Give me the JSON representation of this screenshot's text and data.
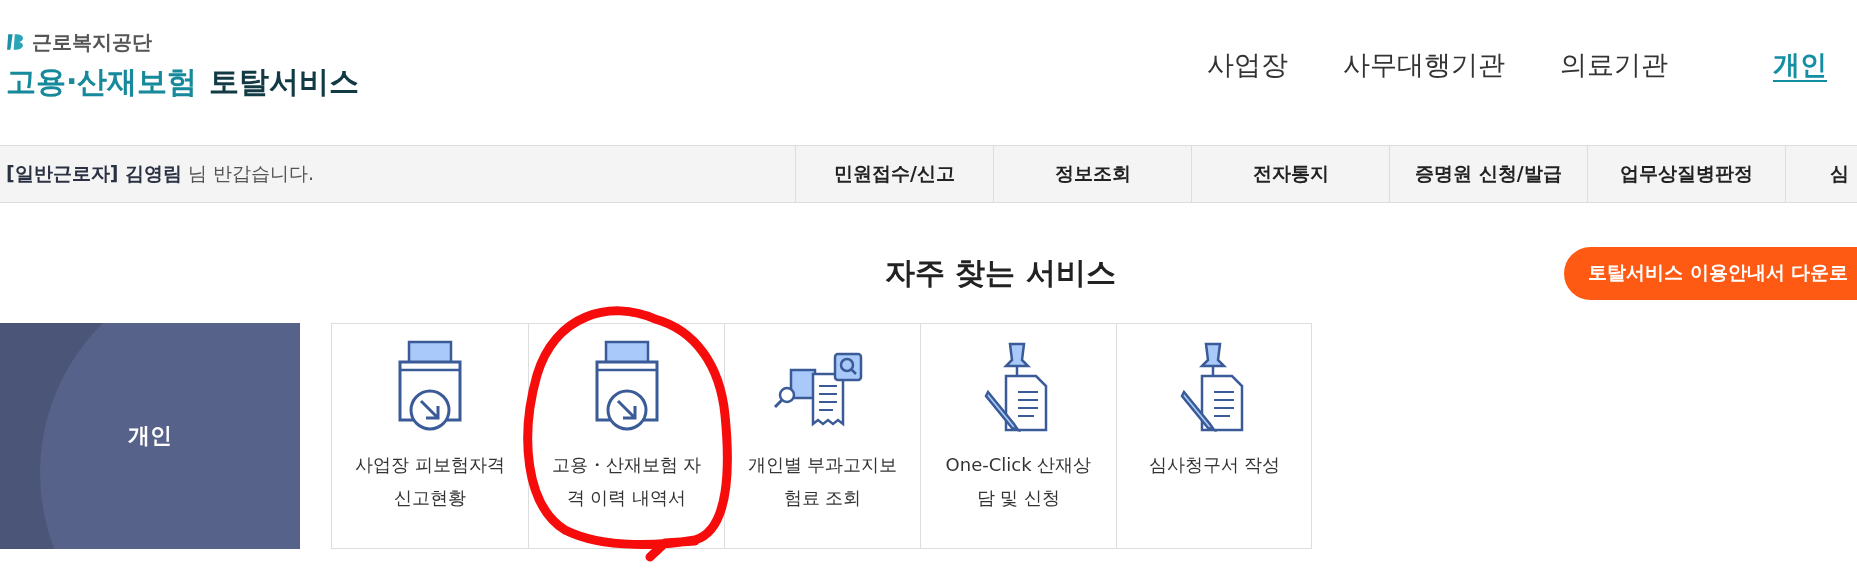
{
  "logo": {
    "org": "근로복지공단",
    "title_main": "고용·산재보험",
    "title_sub": "토탈서비스"
  },
  "top_nav": [
    {
      "label": "사업장",
      "selected": false
    },
    {
      "label": "사무대행기관",
      "selected": false
    },
    {
      "label": "의료기관",
      "selected": false
    },
    {
      "label": "개인",
      "selected": true
    }
  ],
  "user_bar": {
    "greeting": "**[일반근로자] 김영림** 님 반갑습니다.",
    "menu": [
      "민원접수/신고",
      "정보조회",
      "전자통지",
      "증명원 신청/발급",
      "업무상질병판정",
      "심"
    ]
  },
  "section": {
    "title": "자주 찾는 서비스",
    "guide_button": "토탈서비스 이용안내서 다운로"
  },
  "side_panel": {
    "label": "개인"
  },
  "services": [
    {
      "kind": "download",
      "label": "사업장 피보험자격 신고현황"
    },
    {
      "kind": "download",
      "label": "고용・산재보험 자격 이력 내역서"
    },
    {
      "kind": "search",
      "label": "개인별 부과고지보험료 조회"
    },
    {
      "kind": "pin",
      "label": "One-Click 산재상담 및 신청"
    },
    {
      "kind": "pin",
      "label": "심사청구서 작성"
    }
  ]
}
